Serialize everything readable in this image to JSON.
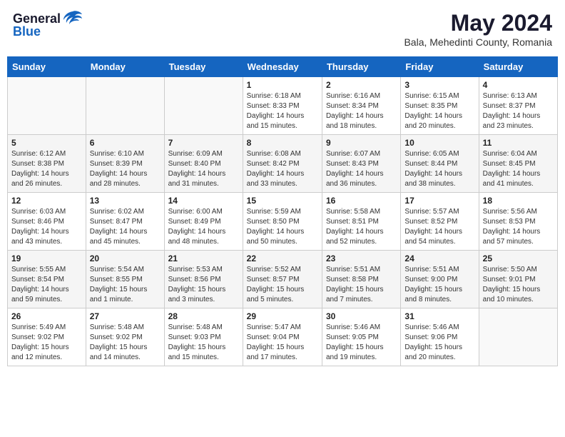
{
  "header": {
    "logo_general": "General",
    "logo_blue": "Blue",
    "title": "May 2024",
    "subtitle": "Bala, Mehedinti County, Romania"
  },
  "weekdays": [
    "Sunday",
    "Monday",
    "Tuesday",
    "Wednesday",
    "Thursday",
    "Friday",
    "Saturday"
  ],
  "weeks": [
    [
      {
        "day": "",
        "info": ""
      },
      {
        "day": "",
        "info": ""
      },
      {
        "day": "",
        "info": ""
      },
      {
        "day": "1",
        "info": "Sunrise: 6:18 AM\nSunset: 8:33 PM\nDaylight: 14 hours\nand 15 minutes."
      },
      {
        "day": "2",
        "info": "Sunrise: 6:16 AM\nSunset: 8:34 PM\nDaylight: 14 hours\nand 18 minutes."
      },
      {
        "day": "3",
        "info": "Sunrise: 6:15 AM\nSunset: 8:35 PM\nDaylight: 14 hours\nand 20 minutes."
      },
      {
        "day": "4",
        "info": "Sunrise: 6:13 AM\nSunset: 8:37 PM\nDaylight: 14 hours\nand 23 minutes."
      }
    ],
    [
      {
        "day": "5",
        "info": "Sunrise: 6:12 AM\nSunset: 8:38 PM\nDaylight: 14 hours\nand 26 minutes."
      },
      {
        "day": "6",
        "info": "Sunrise: 6:10 AM\nSunset: 8:39 PM\nDaylight: 14 hours\nand 28 minutes."
      },
      {
        "day": "7",
        "info": "Sunrise: 6:09 AM\nSunset: 8:40 PM\nDaylight: 14 hours\nand 31 minutes."
      },
      {
        "day": "8",
        "info": "Sunrise: 6:08 AM\nSunset: 8:42 PM\nDaylight: 14 hours\nand 33 minutes."
      },
      {
        "day": "9",
        "info": "Sunrise: 6:07 AM\nSunset: 8:43 PM\nDaylight: 14 hours\nand 36 minutes."
      },
      {
        "day": "10",
        "info": "Sunrise: 6:05 AM\nSunset: 8:44 PM\nDaylight: 14 hours\nand 38 minutes."
      },
      {
        "day": "11",
        "info": "Sunrise: 6:04 AM\nSunset: 8:45 PM\nDaylight: 14 hours\nand 41 minutes."
      }
    ],
    [
      {
        "day": "12",
        "info": "Sunrise: 6:03 AM\nSunset: 8:46 PM\nDaylight: 14 hours\nand 43 minutes."
      },
      {
        "day": "13",
        "info": "Sunrise: 6:02 AM\nSunset: 8:47 PM\nDaylight: 14 hours\nand 45 minutes."
      },
      {
        "day": "14",
        "info": "Sunrise: 6:00 AM\nSunset: 8:49 PM\nDaylight: 14 hours\nand 48 minutes."
      },
      {
        "day": "15",
        "info": "Sunrise: 5:59 AM\nSunset: 8:50 PM\nDaylight: 14 hours\nand 50 minutes."
      },
      {
        "day": "16",
        "info": "Sunrise: 5:58 AM\nSunset: 8:51 PM\nDaylight: 14 hours\nand 52 minutes."
      },
      {
        "day": "17",
        "info": "Sunrise: 5:57 AM\nSunset: 8:52 PM\nDaylight: 14 hours\nand 54 minutes."
      },
      {
        "day": "18",
        "info": "Sunrise: 5:56 AM\nSunset: 8:53 PM\nDaylight: 14 hours\nand 57 minutes."
      }
    ],
    [
      {
        "day": "19",
        "info": "Sunrise: 5:55 AM\nSunset: 8:54 PM\nDaylight: 14 hours\nand 59 minutes."
      },
      {
        "day": "20",
        "info": "Sunrise: 5:54 AM\nSunset: 8:55 PM\nDaylight: 15 hours\nand 1 minute."
      },
      {
        "day": "21",
        "info": "Sunrise: 5:53 AM\nSunset: 8:56 PM\nDaylight: 15 hours\nand 3 minutes."
      },
      {
        "day": "22",
        "info": "Sunrise: 5:52 AM\nSunset: 8:57 PM\nDaylight: 15 hours\nand 5 minutes."
      },
      {
        "day": "23",
        "info": "Sunrise: 5:51 AM\nSunset: 8:58 PM\nDaylight: 15 hours\nand 7 minutes."
      },
      {
        "day": "24",
        "info": "Sunrise: 5:51 AM\nSunset: 9:00 PM\nDaylight: 15 hours\nand 8 minutes."
      },
      {
        "day": "25",
        "info": "Sunrise: 5:50 AM\nSunset: 9:01 PM\nDaylight: 15 hours\nand 10 minutes."
      }
    ],
    [
      {
        "day": "26",
        "info": "Sunrise: 5:49 AM\nSunset: 9:02 PM\nDaylight: 15 hours\nand 12 minutes."
      },
      {
        "day": "27",
        "info": "Sunrise: 5:48 AM\nSunset: 9:02 PM\nDaylight: 15 hours\nand 14 minutes."
      },
      {
        "day": "28",
        "info": "Sunrise: 5:48 AM\nSunset: 9:03 PM\nDaylight: 15 hours\nand 15 minutes."
      },
      {
        "day": "29",
        "info": "Sunrise: 5:47 AM\nSunset: 9:04 PM\nDaylight: 15 hours\nand 17 minutes."
      },
      {
        "day": "30",
        "info": "Sunrise: 5:46 AM\nSunset: 9:05 PM\nDaylight: 15 hours\nand 19 minutes."
      },
      {
        "day": "31",
        "info": "Sunrise: 5:46 AM\nSunset: 9:06 PM\nDaylight: 15 hours\nand 20 minutes."
      },
      {
        "day": "",
        "info": ""
      }
    ]
  ]
}
